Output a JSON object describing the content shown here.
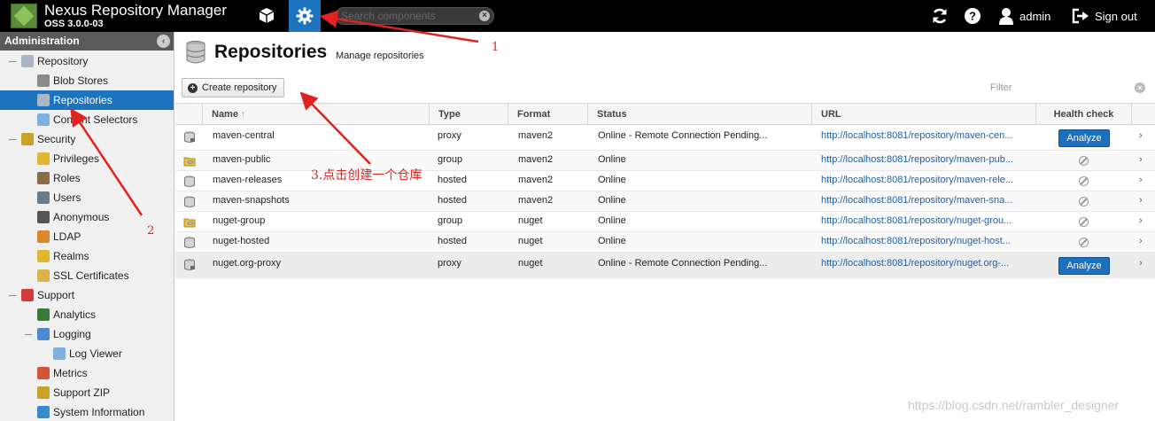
{
  "app": {
    "title": "Nexus Repository Manager",
    "version": "OSS 3.0.0-03"
  },
  "topbar": {
    "search_placeholder": "Search components",
    "user_label": "admin",
    "signout_label": "Sign out"
  },
  "sidebar": {
    "header": "Administration",
    "items": [
      {
        "label": "Repository",
        "level": 0,
        "icon": "database-icon",
        "selected": false
      },
      {
        "label": "Blob Stores",
        "level": 1,
        "icon": "blob-store-icon",
        "selected": false
      },
      {
        "label": "Repositories",
        "level": 1,
        "icon": "database-icon",
        "selected": true
      },
      {
        "label": "Content Selectors",
        "level": 1,
        "icon": "content-selector-icon",
        "selected": false
      },
      {
        "label": "Security",
        "level": 0,
        "icon": "security-icon",
        "selected": false
      },
      {
        "label": "Privileges",
        "level": 1,
        "icon": "privilege-icon",
        "selected": false
      },
      {
        "label": "Roles",
        "level": 1,
        "icon": "roles-icon",
        "selected": false
      },
      {
        "label": "Users",
        "level": 1,
        "icon": "users-icon",
        "selected": false
      },
      {
        "label": "Anonymous",
        "level": 1,
        "icon": "anonymous-icon",
        "selected": false
      },
      {
        "label": "LDAP",
        "level": 1,
        "icon": "ldap-icon",
        "selected": false
      },
      {
        "label": "Realms",
        "level": 1,
        "icon": "realms-icon",
        "selected": false
      },
      {
        "label": "SSL Certificates",
        "level": 1,
        "icon": "certificate-icon",
        "selected": false
      },
      {
        "label": "Support",
        "level": 0,
        "icon": "support-icon",
        "selected": false
      },
      {
        "label": "Analytics",
        "level": 1,
        "icon": "analytics-icon",
        "selected": false
      },
      {
        "label": "Logging",
        "level": 1,
        "icon": "logging-icon",
        "selected": false
      },
      {
        "label": "Log Viewer",
        "level": 2,
        "icon": "log-viewer-icon",
        "selected": false
      },
      {
        "label": "Metrics",
        "level": 1,
        "icon": "metrics-icon",
        "selected": false
      },
      {
        "label": "Support ZIP",
        "level": 1,
        "icon": "zip-icon",
        "selected": false
      },
      {
        "label": "System Information",
        "level": 1,
        "icon": "system-info-icon",
        "selected": false
      }
    ]
  },
  "page": {
    "title": "Repositories",
    "subtitle": "Manage repositories",
    "create_button": "Create repository",
    "filter_placeholder": "Filter"
  },
  "grid": {
    "columns": [
      "Name",
      "Type",
      "Format",
      "Status",
      "URL",
      "Health check"
    ],
    "sort_indicator": "↑",
    "rows": [
      {
        "name": "maven-central",
        "type": "proxy",
        "format": "maven2",
        "status": "Online - Remote Connection Pending...",
        "url": "http://localhost:8081/repository/maven-cen...",
        "health": "Analyze"
      },
      {
        "name": "maven-public",
        "type": "group",
        "format": "maven2",
        "status": "Online",
        "url": "http://localhost:8081/repository/maven-pub...",
        "health": ""
      },
      {
        "name": "maven-releases",
        "type": "hosted",
        "format": "maven2",
        "status": "Online",
        "url": "http://localhost:8081/repository/maven-rele...",
        "health": ""
      },
      {
        "name": "maven-snapshots",
        "type": "hosted",
        "format": "maven2",
        "status": "Online",
        "url": "http://localhost:8081/repository/maven-sna...",
        "health": ""
      },
      {
        "name": "nuget-group",
        "type": "group",
        "format": "nuget",
        "status": "Online",
        "url": "http://localhost:8081/repository/nuget-grou...",
        "health": ""
      },
      {
        "name": "nuget-hosted",
        "type": "hosted",
        "format": "nuget",
        "status": "Online",
        "url": "http://localhost:8081/repository/nuget-host...",
        "health": ""
      },
      {
        "name": "nuget.org-proxy",
        "type": "proxy",
        "format": "nuget",
        "status": "Online - Remote Connection Pending...",
        "url": "http://localhost:8081/repository/nuget.org-...",
        "health": "Analyze"
      }
    ]
  },
  "annotations": {
    "one": "1",
    "two": "2",
    "three": "3.点击创建一个仓库"
  },
  "watermark": "https://blog.csdn.net/rambler_designer",
  "colors": {
    "accent": "#1e73be",
    "topbar": "#000000",
    "annotation": "#e0231f",
    "link": "#1f5fa8"
  }
}
